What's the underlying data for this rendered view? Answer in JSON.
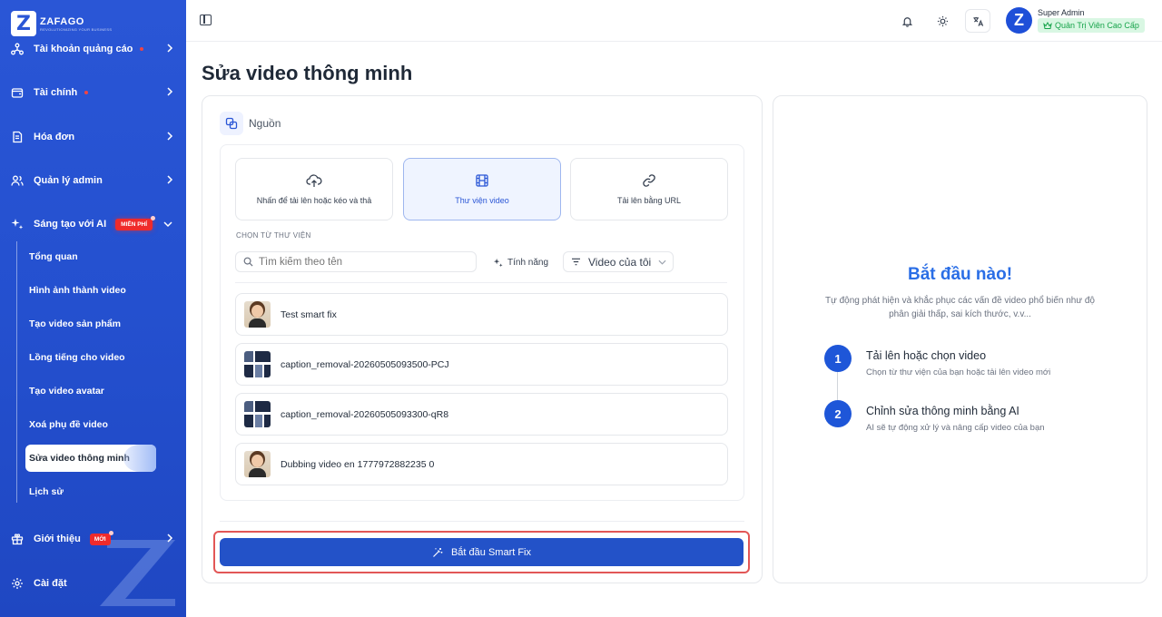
{
  "brand": {
    "name": "ZAFAGO",
    "tagline": "REVOLUTIONIZING YOUR BUSINESS",
    "mark": "Z"
  },
  "sidebar": {
    "items": [
      {
        "label": "Tài khoản quảng cáo",
        "icon": "network-icon"
      },
      {
        "label": "Tài chính",
        "icon": "wallet-icon"
      },
      {
        "label": "Hóa đơn",
        "icon": "invoice-icon"
      },
      {
        "label": "Quản lý admin",
        "icon": "users-icon"
      },
      {
        "label": "Sáng tạo với AI",
        "icon": "sparkles-icon",
        "badge": "MIỄN PHÍ"
      }
    ],
    "subitems": [
      "Tổng quan",
      "Hình ảnh thành video",
      "Tạo video sản phẩm",
      "Lồng tiếng cho video",
      "Tạo video avatar",
      "Xoá phụ đề video",
      "Sửa video thông minh",
      "Lịch sử"
    ],
    "intro": {
      "label": "Giới thiệu",
      "badge": "MỚI"
    },
    "settings": {
      "label": "Cài đặt"
    }
  },
  "header": {
    "user_name": "Super Admin",
    "user_role": "Quản Trị Viên Cao Cấp",
    "avatar_letter": "Z"
  },
  "main": {
    "title": "Sửa video thông minh",
    "source_label": "Nguồn",
    "options": [
      {
        "label": "Nhấn để tải lên hoặc kéo và thả",
        "icon": "upload-cloud-icon"
      },
      {
        "label": "Thư viện video",
        "icon": "film-icon",
        "active": true
      },
      {
        "label": "Tải lên bằng URL",
        "icon": "link-icon"
      }
    ],
    "library_label": "CHỌN TỪ THƯ VIỆN",
    "search_placeholder": "Tìm kiếm theo tên",
    "feature_label": "Tính năng",
    "video_filter": "Video của tôi",
    "videos": [
      {
        "name": "Test smart fix",
        "thumb": "face"
      },
      {
        "name": "caption_removal-20260505093500-PCJ",
        "thumb": "grid"
      },
      {
        "name": "caption_removal-20260505093300-qR8",
        "thumb": "grid"
      },
      {
        "name": "Dubbing video en 1777972882235 0",
        "thumb": "face"
      }
    ],
    "cta_label": "Bắt đầu Smart Fix"
  },
  "right": {
    "title": "Bắt đầu nào!",
    "description": "Tự động phát hiện và khắc phục các vấn đề video phổ biến như độ phân giải thấp, sai kích thước, v.v...",
    "steps": [
      {
        "num": "1",
        "title": "Tải lên hoặc chọn video",
        "sub": "Chọn từ thư viện của bạn hoặc tải lên video mới"
      },
      {
        "num": "2",
        "title": "Chỉnh sửa thông minh bằng AI",
        "sub": "AI sẽ tự động xử lý và nâng cấp video của bạn"
      }
    ]
  },
  "colors": {
    "sidebar": "#2a56d6",
    "accent": "#2352c8",
    "title_blue": "#2a6ee6",
    "highlight": "#e25656"
  }
}
